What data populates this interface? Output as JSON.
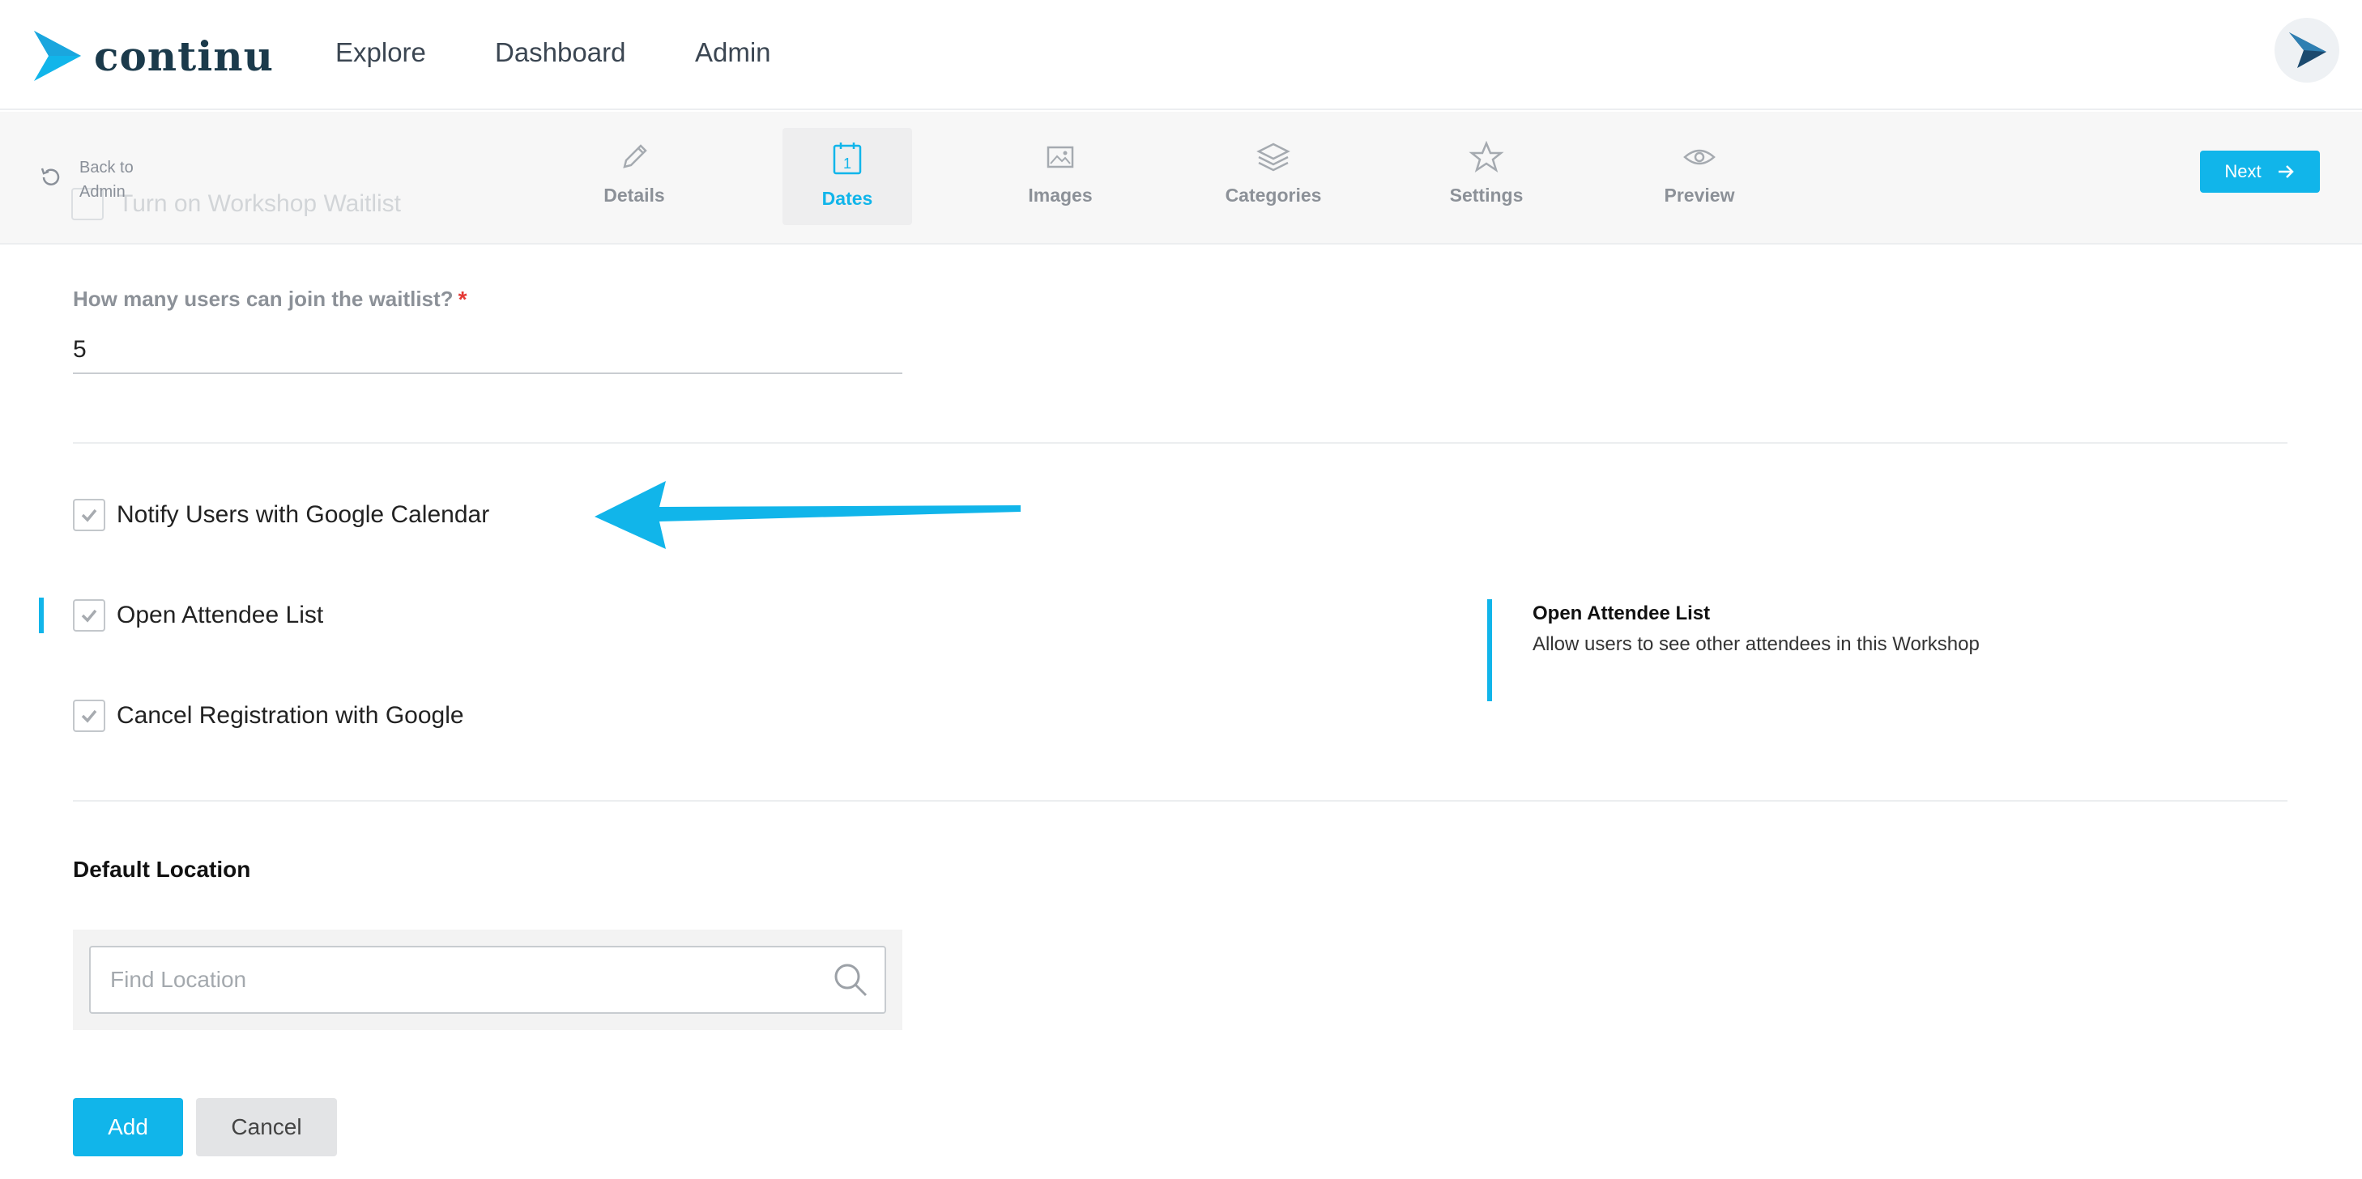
{
  "app": {
    "brand": "continu"
  },
  "nav": {
    "items": [
      "Explore",
      "Dashboard",
      "Admin"
    ]
  },
  "wizard": {
    "back_label": "Back to Admin",
    "ghost_text": "Turn on Workshop Waitlist",
    "steps": [
      {
        "label": "Details",
        "icon": "pencil-icon"
      },
      {
        "label": "Dates",
        "icon": "calendar-icon",
        "active": true
      },
      {
        "label": "Images",
        "icon": "image-icon"
      },
      {
        "label": "Categories",
        "icon": "layers-icon"
      },
      {
        "label": "Settings",
        "icon": "star-icon"
      },
      {
        "label": "Preview",
        "icon": "eye-icon"
      }
    ],
    "next_label": "Next",
    "calendar_day": "1"
  },
  "form": {
    "waitlist_label": "How many users can join the waitlist?",
    "required_mark": "*",
    "waitlist_value": "5",
    "options": [
      {
        "label": "Notify Users with Google Calendar",
        "checked": true
      },
      {
        "label": "Open Attendee List",
        "checked": true
      },
      {
        "label": "Cancel Registration with Google",
        "checked": true
      }
    ],
    "help": {
      "title": "Open Attendee List",
      "text": "Allow users to see other attendees in this Workshop"
    },
    "location": {
      "title": "Default Location",
      "placeholder": "Find Location"
    },
    "buttons": {
      "add": "Add",
      "cancel": "Cancel"
    }
  },
  "colors": {
    "accent": "#11b5ea",
    "brand_dark": "#1b3a4b",
    "required": "#e53935"
  }
}
